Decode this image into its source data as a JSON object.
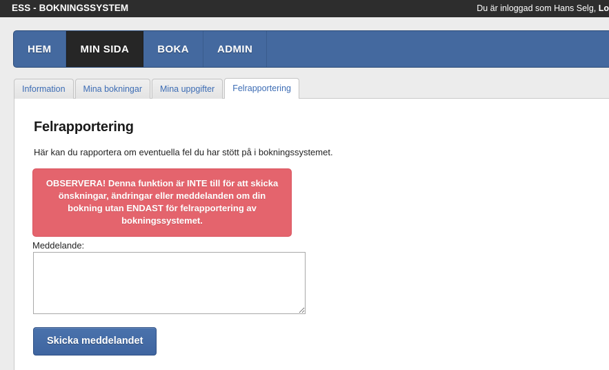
{
  "topbar": {
    "brand": "ESS - BOKNINGSSYSTEM",
    "user_text": "Du är inloggad som Hans Selg, ",
    "logout_label": "Lo"
  },
  "main_nav": {
    "items": [
      {
        "label": "HEM",
        "active": false
      },
      {
        "label": "MIN SIDA",
        "active": true
      },
      {
        "label": "BOKA",
        "active": false
      },
      {
        "label": "ADMIN",
        "active": false
      }
    ]
  },
  "sub_tabs": {
    "items": [
      {
        "label": "Information",
        "active": false
      },
      {
        "label": "Mina bokningar",
        "active": false
      },
      {
        "label": "Mina uppgifter",
        "active": false
      },
      {
        "label": "Felrapportering",
        "active": true
      }
    ]
  },
  "content": {
    "title": "Felrapportering",
    "description": "Här kan du rapportera om eventuella fel du har stött på i bokningssystemet.",
    "alert_text": "OBSERVERA! Denna funktion är INTE till för att skicka önskningar, ändringar eller meddelanden om din bokning utan ENDAST för felrapportering av bokningssystemet.",
    "message_label": "Meddelande:",
    "message_value": "",
    "message_placeholder": "",
    "submit_label": "Skicka meddelandet"
  },
  "colors": {
    "header_dark": "#2d2d2d",
    "nav_blue": "#44699f",
    "nav_active_dark": "#262626",
    "tab_link_blue": "#3c6cb4",
    "alert_red": "#e4646d",
    "alert_border": "#d9535e",
    "button_blue": "#4a72ac",
    "page_background": "#ececec",
    "panel_white": "#ffffff"
  }
}
